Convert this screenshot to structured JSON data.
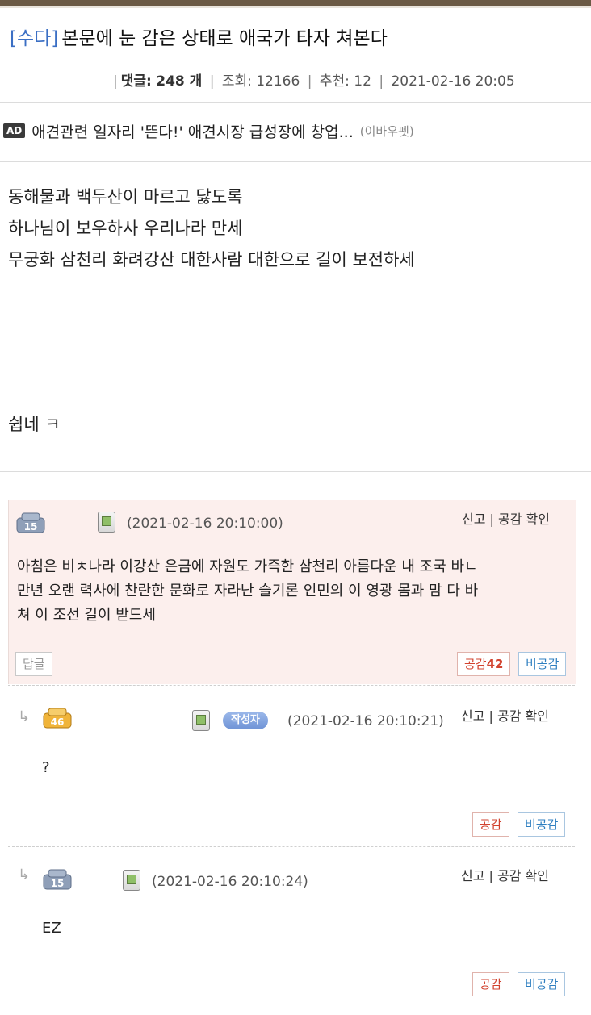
{
  "post": {
    "category": "[수다]",
    "title": "본문에 눈 감은 상태로 애국가 타자 쳐본다",
    "meta": {
      "comments_label": "댓글:",
      "comments_count": "248 개",
      "views": "조회: 12166",
      "recommends": "추천: 12",
      "datetime": "2021-02-16 20:05"
    }
  },
  "ad": {
    "badge": "AD",
    "text": "애견관련 일자리 '뜬다!' 애견시장 급성장에 창업...",
    "source": "(이바우펫)"
  },
  "body": {
    "lines": [
      "동해물과 백두산이 마르고 닳도록",
      "하나님이 보우하사 우리나라 만세",
      "무궁화 삼천리 화려강산 대한사람 대한으로 길이 보전하세"
    ],
    "footer": "쉽네 ㅋ"
  },
  "comments": [
    {
      "level": "15",
      "date": "(2021-02-16 20:10:00)",
      "actions": "신고 | 공감 확인",
      "text_lines": [
        "아침은 비ㅊ나라 이강산 은금에 자원도 가즉한 삼천리 아름다운 내 조국 바ㄴ",
        "만년 오랜 력사에 찬란한 문화로 자라난 슬기론 인민의 이 영광 몸과 맘 다 바",
        "쳐 이 조선 길이 받드세"
      ],
      "reply_label": "답글",
      "like_label": "공감",
      "like_count": "42",
      "dislike_label": "비공감"
    },
    {
      "level": "46",
      "author_badge": "작성자",
      "date": "(2021-02-16 20:10:21)",
      "actions": "신고 | 공감 확인",
      "text": "?",
      "like_label": "공감",
      "dislike_label": "비공감"
    },
    {
      "level": "15",
      "date": "(2021-02-16 20:10:24)",
      "actions": "신고 | 공감 확인",
      "text": "EZ",
      "like_label": "공감",
      "dislike_label": "비공감"
    }
  ],
  "icons": {
    "reply_arrow": "↳",
    "phone": "mobile-phone-icon",
    "level_badge": "level-badge-icon"
  },
  "colors": {
    "category": "#3b6fc4",
    "comment_highlight_bg": "#fcefed",
    "like": "#d2432f",
    "dislike": "#2f7fc0",
    "author_badge": "#7a9ee0",
    "level46_badge": "#f0b43a"
  }
}
